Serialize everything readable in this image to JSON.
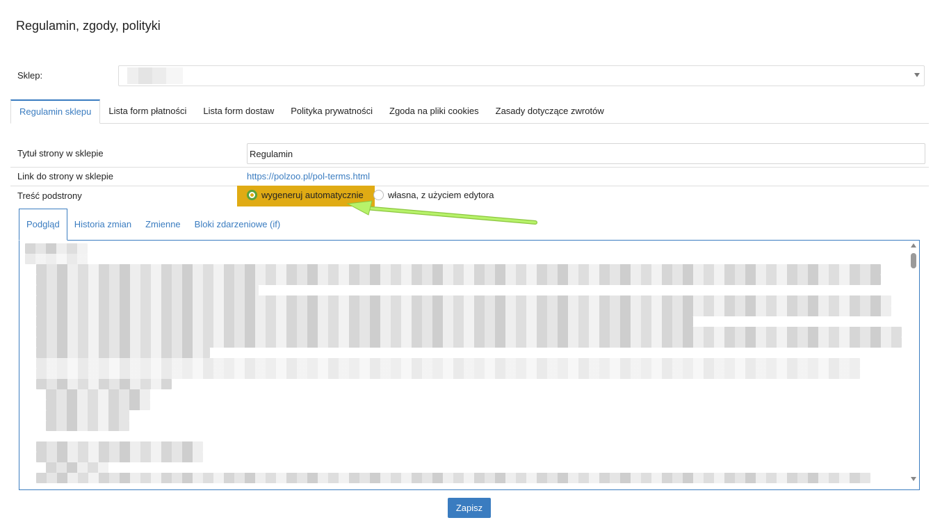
{
  "page": {
    "title": "Regulamin, zgody, polityki"
  },
  "shop": {
    "label": "Sklep:",
    "value": ""
  },
  "tabs": [
    {
      "label": "Regulamin sklepu",
      "active": true
    },
    {
      "label": "Lista form płatności",
      "active": false
    },
    {
      "label": "Lista form dostaw",
      "active": false
    },
    {
      "label": "Polityka prywatności",
      "active": false
    },
    {
      "label": "Zgoda na pliki cookies",
      "active": false
    },
    {
      "label": "Zasady dotyczące zwrotów",
      "active": false
    }
  ],
  "form": {
    "title_label": "Tytuł strony w sklepie",
    "title_value": "Regulamin",
    "link_label": "Link do strony w sklepie",
    "link_value": "https://polzoo.pl/pol-terms.html",
    "content_label": "Treść podstrony",
    "content_options": [
      {
        "label": "wygeneruj automatycznie",
        "checked": true
      },
      {
        "label": "własna, z użyciem edytora",
        "checked": false
      }
    ]
  },
  "subtabs": [
    {
      "label": "Podgląd",
      "active": true
    },
    {
      "label": "Historia zmian",
      "active": false
    },
    {
      "label": "Zmienne",
      "active": false
    },
    {
      "label": "Bloki zdarzeniowe (if)",
      "active": false
    }
  ],
  "actions": {
    "save_label": "Zapisz"
  },
  "colors": {
    "accent": "#3a7cc0",
    "highlight": "#e0ab14",
    "arrow": "#b7f26a"
  }
}
